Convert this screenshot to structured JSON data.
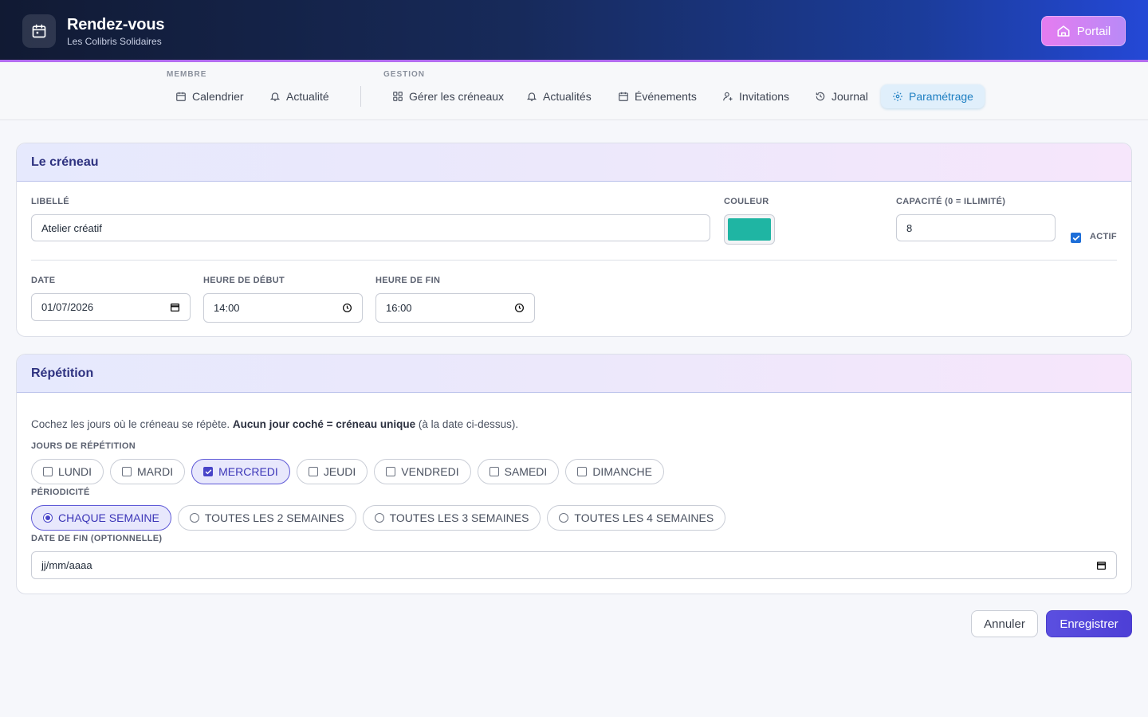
{
  "header": {
    "title": "Rendez-vous",
    "subtitle": "Les Colibris Solidaires",
    "portail_label": "Portail"
  },
  "nav": {
    "membre_label": "MEMBRE",
    "gestion_label": "GESTION",
    "items": [
      {
        "label": "Calendrier",
        "icon": "calendar-icon"
      },
      {
        "label": "Actualité",
        "icon": "bell-icon"
      },
      {
        "label": "Gérer les créneaux",
        "icon": "grid-icon"
      },
      {
        "label": "Actualités",
        "icon": "bell-icon"
      },
      {
        "label": "Événements",
        "icon": "calendar-icon"
      },
      {
        "label": "Invitations",
        "icon": "user-plus-icon"
      },
      {
        "label": "Journal",
        "icon": "history-icon"
      },
      {
        "label": "Paramétrage",
        "icon": "gear-icon"
      }
    ],
    "active": "Paramétrage"
  },
  "creneau": {
    "title": "Le créneau",
    "libelle_label": "LIBELLÉ",
    "libelle_value": "Atelier créatif",
    "couleur_label": "COULEUR",
    "couleur_value": "#1fb5a3",
    "capacite_label": "CAPACITÉ (0 = ILLIMITÉ)",
    "capacite_value": "8",
    "actif_label": "ACTIF",
    "actif_checked": true,
    "date_label": "DATE",
    "date_value": "01/07/2026",
    "debut_label": "HEURE DE DÉBUT",
    "debut_value": "14:00",
    "fin_label": "HEURE DE FIN",
    "fin_value": "16:00"
  },
  "repetition": {
    "title": "Répétition",
    "help_prefix": "Cochez les jours où le créneau se répète. ",
    "help_bold": "Aucun jour coché = créneau unique",
    "help_suffix": " (à la date ci-dessus).",
    "jours_label": "JOURS DE RÉPÉTITION",
    "jours": [
      {
        "label": "LUNDI",
        "checked": false
      },
      {
        "label": "MARDI",
        "checked": false
      },
      {
        "label": "MERCREDI",
        "checked": true
      },
      {
        "label": "JEUDI",
        "checked": false
      },
      {
        "label": "VENDREDI",
        "checked": false
      },
      {
        "label": "SAMEDI",
        "checked": false
      },
      {
        "label": "DIMANCHE",
        "checked": false
      }
    ],
    "periodicite_label": "PÉRIODICITÉ",
    "periodicites": [
      {
        "label": "CHAQUE SEMAINE",
        "selected": true
      },
      {
        "label": "TOUTES LES 2 SEMAINES",
        "selected": false
      },
      {
        "label": "TOUTES LES 3 SEMAINES",
        "selected": false
      },
      {
        "label": "TOUTES LES 4 SEMAINES",
        "selected": false
      }
    ],
    "date_fin_label": "DATE DE FIN (OPTIONNELLE)",
    "date_fin_placeholder": "jj/mm/aaaa"
  },
  "actions": {
    "cancel_label": "Annuler",
    "save_label": "Enregistrer"
  },
  "colors": {
    "accent": "#4d3fd6",
    "active_nav": "#1e7fc2"
  }
}
